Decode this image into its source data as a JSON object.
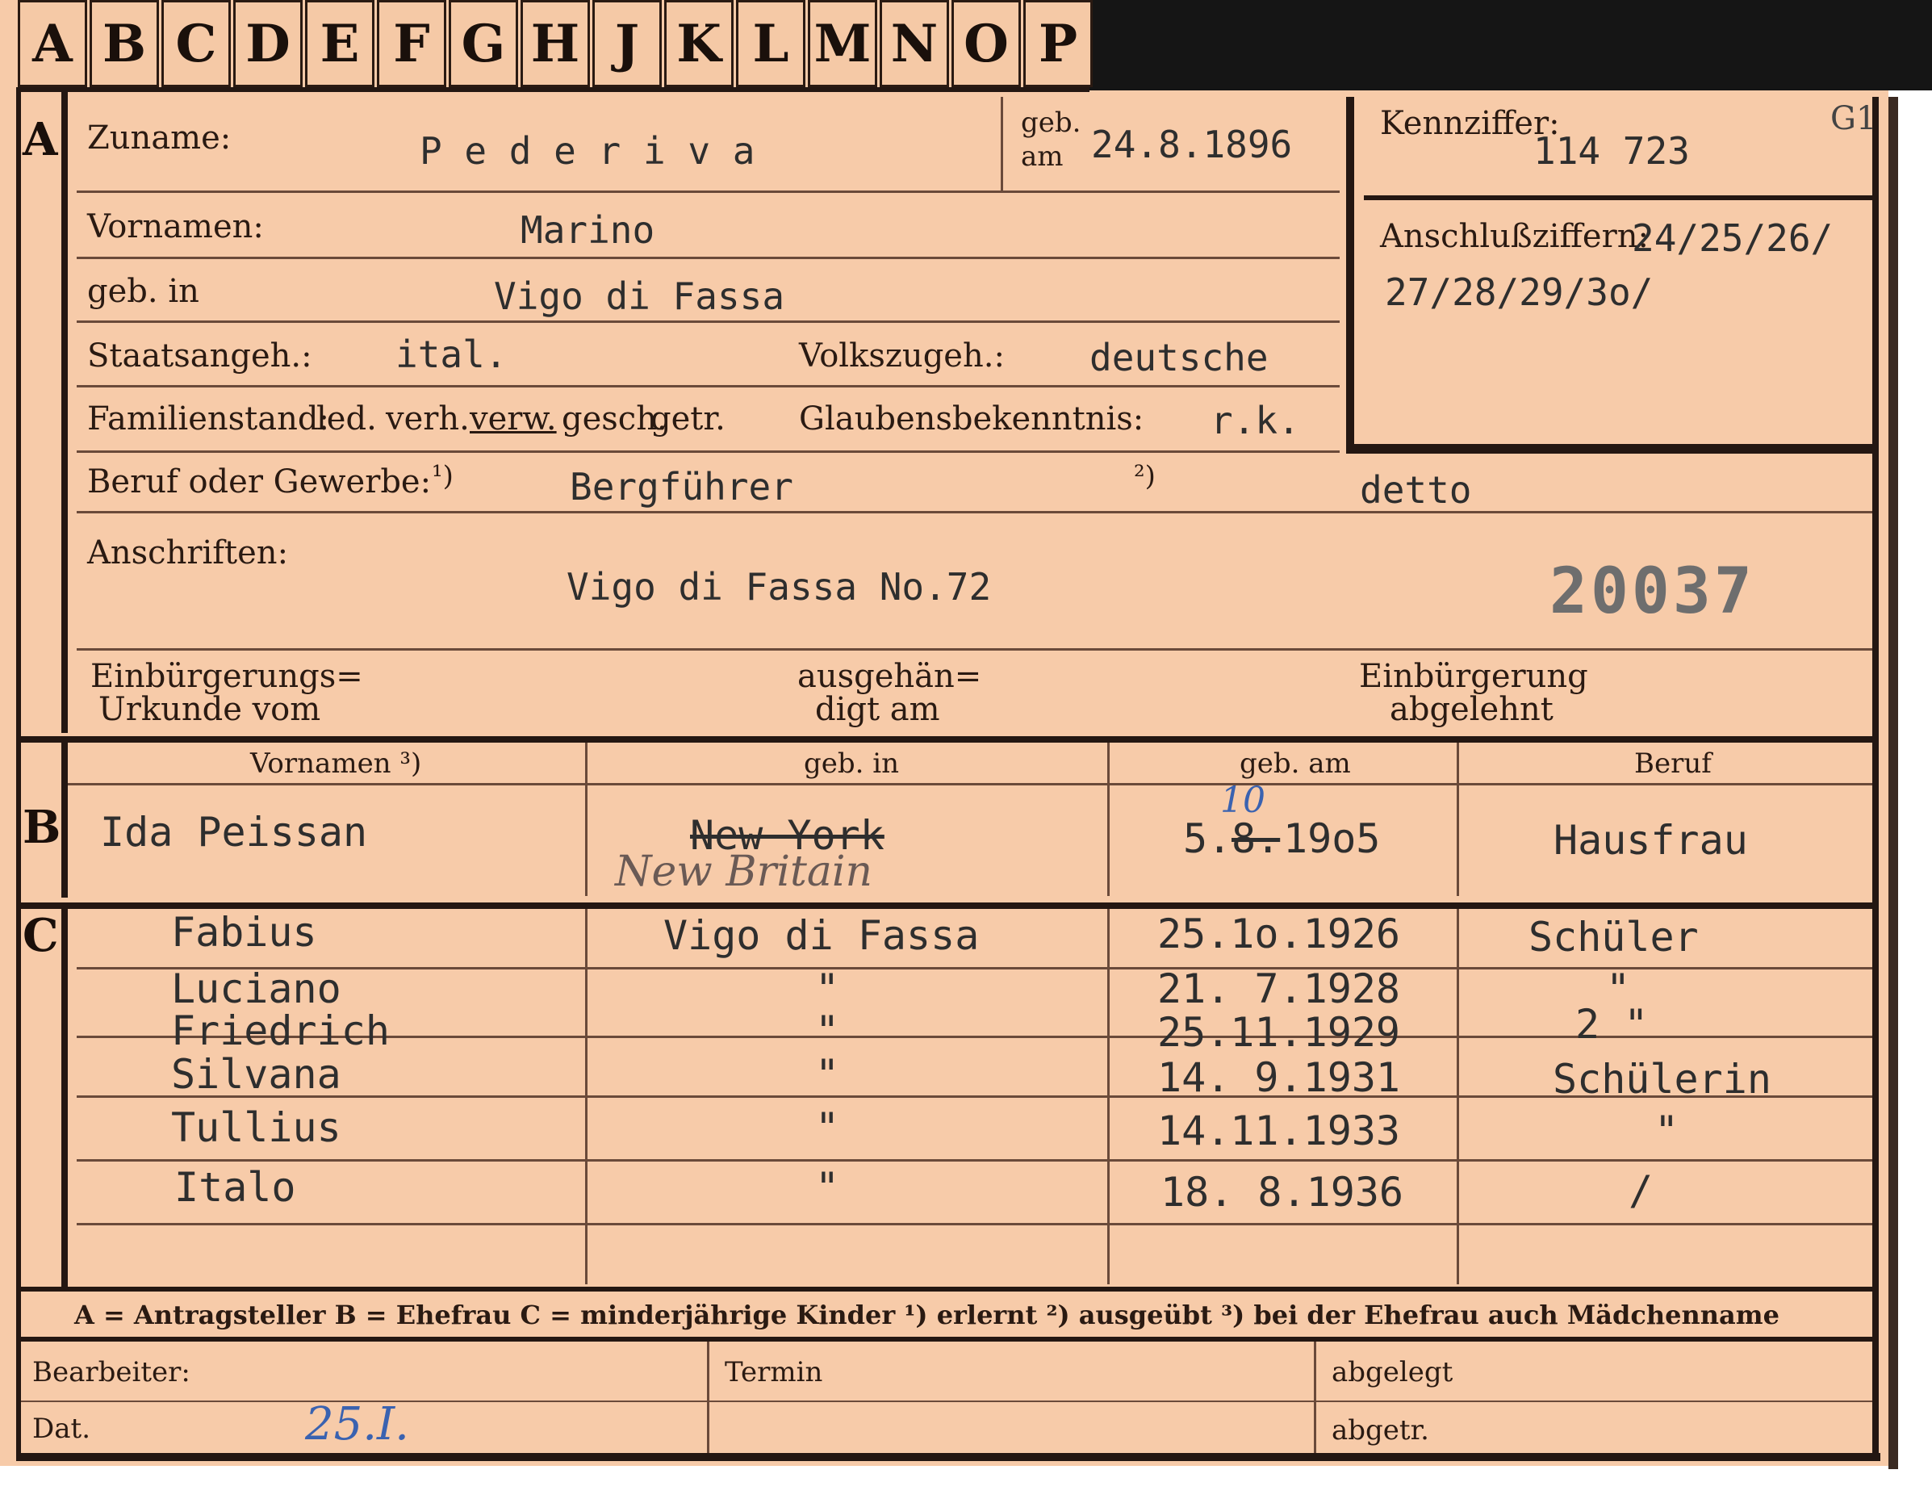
{
  "tabs": [
    "A",
    "B",
    "C",
    "D",
    "E",
    "F",
    "G",
    "H",
    "J",
    "K",
    "L",
    "M",
    "N",
    "O",
    "P"
  ],
  "section_letters": {
    "a": "A",
    "b": "B",
    "c": "C"
  },
  "labels": {
    "zuname": "Zuname:",
    "geb_am_top": "geb.",
    "geb_am_bottom": "am",
    "kennziffer": "Kennziffer:",
    "kennziffer_code": "G1",
    "vornamen": "Vornamen:",
    "anschlussziffern": "Anschlußziffern:",
    "geb_in": "geb. in",
    "staatsangeh": "Staatsangeh.:",
    "volkszugeh": "Volkszugeh.:",
    "familienstand": "Familienstand:",
    "fam_options": [
      "led.",
      "verh.",
      "verw.",
      "gesch.",
      "getr."
    ],
    "glaubensbekenntnis": "Glaubensbekenntnis:",
    "beruf": "Beruf oder Gewerbe:",
    "beruf_note1": "¹)",
    "beruf_note2": "²)",
    "anschriften": "Anschriften:",
    "einb_urkunde_1": "Einbürgerungs=",
    "einb_urkunde_2": "Urkunde vom",
    "ausgehaendigt_1": "ausgehän=",
    "ausgehaendigt_2": "digt am",
    "einb_abgelehnt_1": "Einbürgerung",
    "einb_abgelehnt_2": "abgelehnt",
    "col_vornamen": "Vornamen ³)",
    "col_geb_in": "geb. in",
    "col_geb_am": "geb. am",
    "col_beruf": "Beruf",
    "legend": "A = Antragsteller   B = Ehefrau   C = minderjährige Kinder   ¹) erlernt   ²) ausgeübt   ³) bei der Ehefrau auch Mädchenname",
    "bearbeiter": "Bearbeiter:",
    "termin": "Termin",
    "abgelegt": "abgelegt",
    "dat": "Dat.",
    "abgetr": "abgetr."
  },
  "applicant": {
    "zuname": "P e d e r i v a",
    "geb_am": "24.8.1896",
    "kennziffer": "114 723",
    "anschluss_1": "24/25/26/",
    "anschluss_2": "27/28/29/3o/",
    "vornamen": "Marino",
    "geb_in": "Vigo di Fassa",
    "staatsangeh": "ital.",
    "volkszugeh": "deutsche",
    "glaube": "r.k.",
    "beruf_erlernt": "Bergführer",
    "beruf_ausgeuebt": "detto",
    "anschrift": "Vigo di Fassa No.72",
    "stamp_number": "20037"
  },
  "wife": {
    "vornamen": "Ida Peissan",
    "geb_in_struck": "New York",
    "geb_in_hand": "New Britain",
    "geb_am_prefix": "5.",
    "geb_am_struck": "8.",
    "geb_am_year": "19o5",
    "geb_am_correction": "10",
    "beruf": "Hausfrau"
  },
  "children": [
    {
      "name": "Fabius",
      "place": "Vigo di Fassa",
      "date": "25.1o.1926",
      "job": "Schüler"
    },
    {
      "name": "Luciano",
      "place": "\"",
      "date": "21. 7.1928",
      "job": "\""
    },
    {
      "name": "Friedrich",
      "place": "\"",
      "date": "25.11.1929",
      "job": "2 \""
    },
    {
      "name": "Silvana",
      "place": "\"",
      "date": "14. 9.1931",
      "job": "Schülerin"
    },
    {
      "name": "Tullius",
      "place": "\"",
      "date": "14.11.1933",
      "job": "\""
    },
    {
      "name": "Italo",
      "place": "\"",
      "date": "18. 8.1936",
      "job": "/"
    }
  ],
  "footer": {
    "dat_value": "25.I."
  }
}
